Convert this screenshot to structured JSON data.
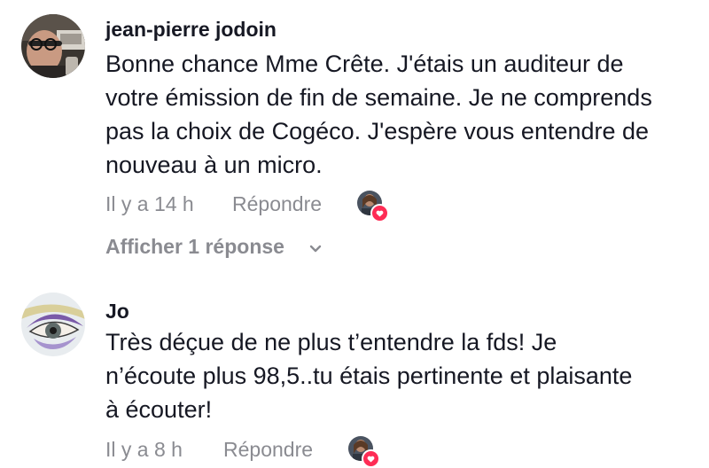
{
  "comments": [
    {
      "username": "jean-pierre jodoin",
      "text_lines": [
        "Bonne chance Mme Crête. J'étais un auditeur de",
        "votre émission de fin de semaine. Je ne comprends",
        "pas la choix de Cogéco. J'espère vous entendre de",
        "nouveau à un micro."
      ],
      "time": "Il y a 14 h",
      "reply_label": "Répondre",
      "view_replies_label": "Afficher 1 réponse",
      "liked_by_creator": true
    },
    {
      "username": "Jo",
      "text_lines": [
        "Très déçue de ne plus t’entendre la fds! Je",
        "n’écoute plus 98,5..tu étais pertinente et plaisante",
        "à écouter!"
      ],
      "time": "Il y a 8 h",
      "reply_label": "Répondre",
      "liked_by_creator": true
    }
  ],
  "icons": {
    "avatar_1": "user-photo-avatar",
    "avatar_2": "eye-painting-avatar",
    "creator_like": "creator-avatar-heart-badge",
    "expand": "chevron-down-icon"
  },
  "colors": {
    "text_primary": "#161823",
    "text_secondary": "#8a8b91",
    "heart": "#fe2c55"
  }
}
